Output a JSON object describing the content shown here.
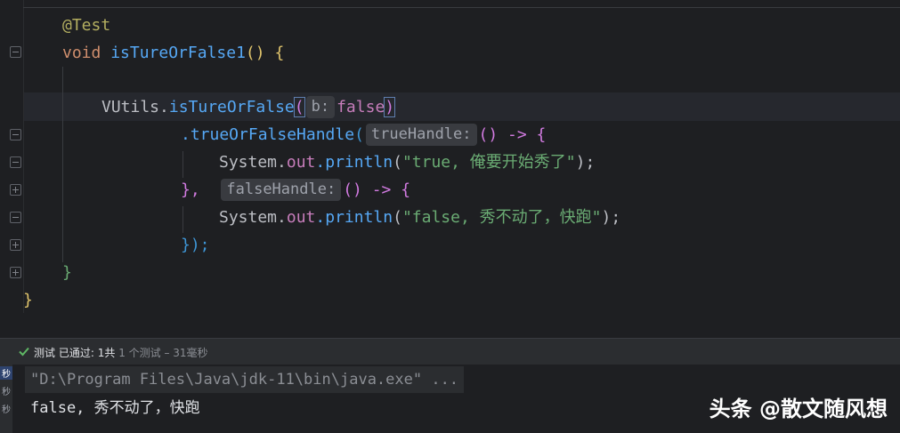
{
  "editor": {
    "annotation": "@Test",
    "kw_void": "void",
    "method_name": "isTureOrFalse1",
    "method_parens": "()",
    "open_brace": "{",
    "util_class": "VUtils",
    "dot": ".",
    "util_method": "isTureOrFalse",
    "hint_b": "b:",
    "kw_false": "false",
    "handle_method": ".trueOrFalseHandle",
    "hint_true": "trueHandle:",
    "arrow": "() -> {",
    "system": "System",
    "out_field": "out",
    "println": ".println",
    "str_true": "\"true, 俺要开始秀了\"",
    "str_false": "\"false, 秀不动了，快跑\"",
    "semicolon": ");",
    "close_comma": "},",
    "hint_false": "falseHandle:",
    "close_paren": "});",
    "close_method": "}",
    "close_class": "}"
  },
  "run": {
    "status_label": "测试",
    "status_passed": "已通过:",
    "status_count": "1共",
    "status_detail": "1 个测试 – 31毫秒",
    "side_labels": [
      "秒",
      "秒",
      "秒"
    ],
    "command": "\"D:\\Program Files\\Java\\jdk-11\\bin\\java.exe\" ...",
    "output": "false, 秀不动了，快跑"
  },
  "watermark": "头条 @散文随风想",
  "colors": {
    "background": "#1e1f22",
    "keyword": "#cf8e6d",
    "method": "#56a8f5",
    "string": "#6aab73",
    "field": "#c77dbb",
    "annotation": "#b3ae60",
    "pass": "#5fb865"
  }
}
